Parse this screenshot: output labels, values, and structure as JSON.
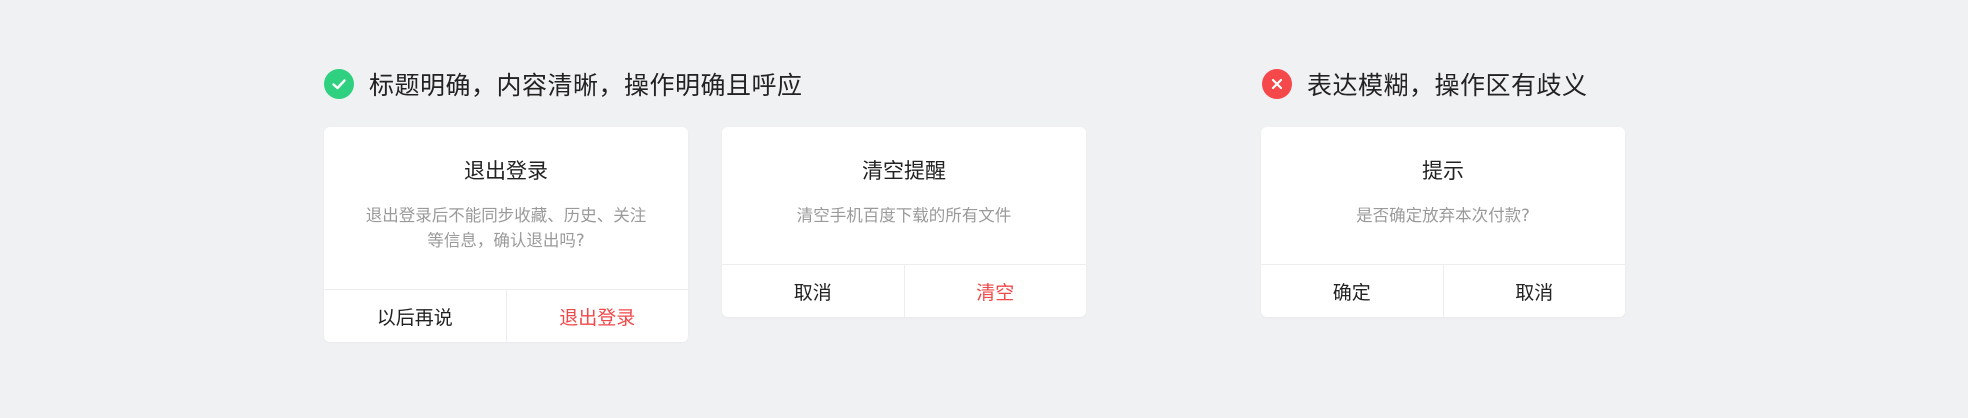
{
  "good_section": {
    "icon": "check-circle-icon",
    "color": "#2fd07f",
    "title": "标题明确，内容清晰，操作明确且呼应"
  },
  "bad_section": {
    "icon": "close-circle-icon",
    "color": "#f5484a",
    "title": "表达模糊，操作区有歧义"
  },
  "dialogs": [
    {
      "title": "退出登录",
      "message_line1": "退出登录后不能同步收藏、历史、关注",
      "message_line2": "等信息，确认退出吗?",
      "left_button": "以后再说",
      "right_button": "退出登录",
      "danger_color": "#f0494a"
    },
    {
      "title": "清空提醒",
      "message_line1": "清空手机百度下载的所有文件",
      "left_button": "取消",
      "right_button": "清空",
      "danger_color": "#f0494a"
    },
    {
      "title": "提示",
      "message_line1": "是否确定放弃本次付款?",
      "left_button": "确定",
      "right_button": "取消"
    }
  ]
}
